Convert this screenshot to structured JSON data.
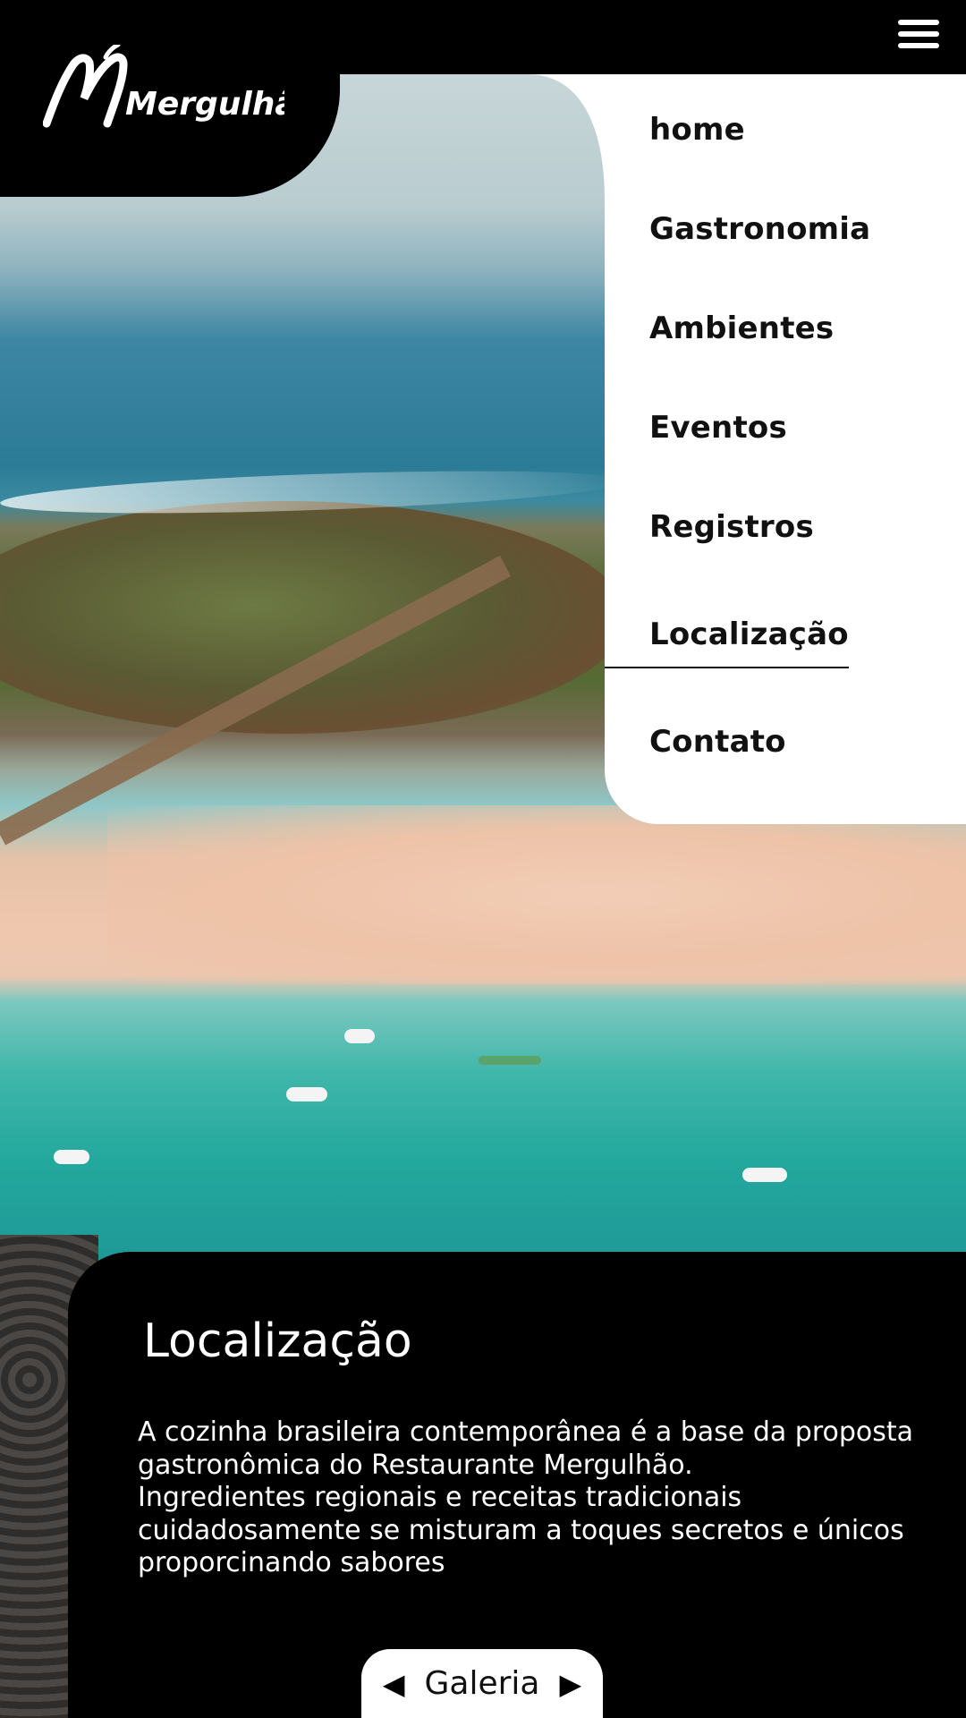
{
  "brand": {
    "logo_text": "Mergulhão"
  },
  "header": {
    "menu_icon": "hamburger-icon"
  },
  "nav": {
    "items": [
      {
        "label": "home"
      },
      {
        "label": "Gastronomia"
      },
      {
        "label": "Ambientes"
      },
      {
        "label": "Eventos"
      },
      {
        "label": "Registros"
      },
      {
        "label": "Localização",
        "active": true
      },
      {
        "label": "Contato"
      }
    ]
  },
  "section": {
    "title": "Localização",
    "paragraph_1": "A cozinha brasileira contemporânea é a base da proposta gastronômica do Restaurante Mergulhão.",
    "paragraph_2": "Ingredientes regionais e receitas tradicionais cuidadosamente se misturam a toques secretos e únicos proporcinando sabores"
  },
  "gallery": {
    "label": "Galeria",
    "prev_icon": "triangle-left-icon",
    "next_icon": "triangle-right-icon"
  },
  "colors": {
    "background": "#000000",
    "menu_panel": "#ffffff",
    "text_light": "#ffffff",
    "text_dark": "#111111"
  }
}
